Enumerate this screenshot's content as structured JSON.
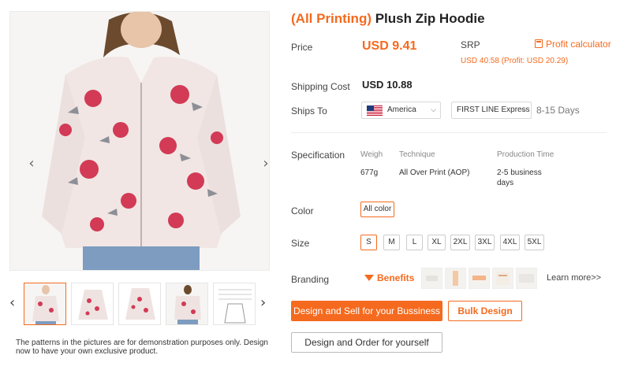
{
  "gallery": {
    "prev_arrow": "‹",
    "next_arrow": "›",
    "thumb_prev": "‹",
    "thumb_next": "›",
    "note": "The patterns in the pictures are for demonstration purposes only. Design now to have your own exclusive product."
  },
  "product": {
    "title_highlight": "(All Printing)",
    "title_rest": " Plush Zip Hoodie"
  },
  "price": {
    "label": "Price",
    "value": "USD 9.41",
    "srp_label": "SRP",
    "profit_calculator": "Profit calculator",
    "srp_value": "USD 40.58 (Profit: USD 20.29)"
  },
  "shipping": {
    "cost_label": "Shipping Cost",
    "cost_value": "USD 10.88",
    "ships_to_label": "Ships To",
    "country": "America",
    "line": "FIRST LINE Express",
    "days": "8-15 Days"
  },
  "specification": {
    "label": "Specification",
    "headers": {
      "weight": "Weigh",
      "technique": "Technique",
      "production": "Production Time"
    },
    "values": {
      "weight": "677g",
      "technique": "All Over Print (AOP)",
      "production": "2-5 business days"
    }
  },
  "color": {
    "label": "Color",
    "selected": "All color"
  },
  "size": {
    "label": "Size",
    "options": [
      "S",
      "M",
      "L",
      "XL",
      "2XL",
      "3XL",
      "4XL",
      "5XL"
    ],
    "selected": "S"
  },
  "branding": {
    "label": "Branding",
    "benefits": "Benefits",
    "learn_more": "Learn more>>"
  },
  "actions": {
    "design_sell": "Design and Sell for your Bussiness",
    "bulk_design": "Bulk Design",
    "design_order": "Design and Order for yourself"
  },
  "colors": {
    "accent": "#f56a1e",
    "border": "#d9d9d9"
  },
  "icons": {
    "calculator": "calculator-icon",
    "flag": "us-flag-icon",
    "benefits": "crown-icon"
  }
}
